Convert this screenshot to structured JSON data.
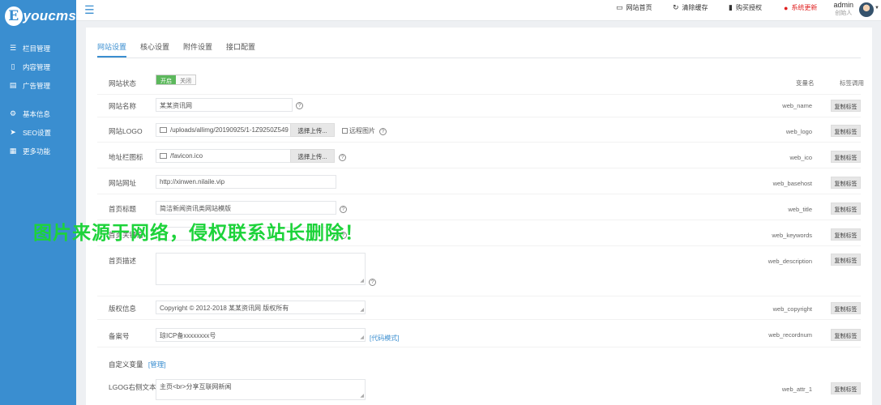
{
  "logo": {
    "mark": "E",
    "text": "youcms"
  },
  "sidebar": {
    "group1": [
      {
        "icon": "☰",
        "label": "栏目管理"
      },
      {
        "icon": "▯",
        "label": "内容管理"
      },
      {
        "icon": "▤",
        "label": "广告管理"
      }
    ],
    "group2": [
      {
        "icon": "⚙",
        "label": "基本信息"
      },
      {
        "icon": "➤",
        "label": "SEO设置"
      },
      {
        "icon": "▦",
        "label": "更多功能"
      }
    ]
  },
  "topbar": {
    "site_home": "网站首页",
    "clear_cache": "清除缓存",
    "buy_license": "购买授权",
    "system_update": "系统更新",
    "admin_name": "admin",
    "admin_role": "创始人"
  },
  "tabs": [
    "网站设置",
    "核心设置",
    "附件设置",
    "接口配置"
  ],
  "headers": {
    "var_name": "变量名",
    "tag_call": "标签调用"
  },
  "copy_label": "复制标签",
  "upload_label": "选择上传...",
  "remote_label": "远程图片",
  "code_mode": "[代码模式]",
  "help_mark": "?",
  "fields": {
    "status": {
      "label": "网站状态",
      "on": "开启",
      "off": "关闭"
    },
    "name": {
      "label": "网站名称",
      "value": "某某资讯网",
      "var": "web_name"
    },
    "logo": {
      "label": "网站LOGO",
      "value": "/uploads/allimg/20190925/1-1Z9250Z549",
      "var": "web_logo"
    },
    "ico": {
      "label": "地址栏图标",
      "value": "/favicon.ico",
      "var": "web_ico"
    },
    "basehost": {
      "label": "网站网址",
      "value": "http://xinwen.nilaile.vip",
      "var": "web_basehost"
    },
    "title": {
      "label": "首页标题",
      "value": "简洁新闻资讯类网站模版",
      "var": "web_title"
    },
    "keywords": {
      "label": "首页关键词",
      "value": "",
      "var": "web_keywords"
    },
    "description": {
      "label": "首页描述",
      "value": "",
      "var": "web_description"
    },
    "copyright": {
      "label": "版权信息",
      "value": "Copyright © 2012-2018 某某资讯网 版权所有",
      "var": "web_copyright"
    },
    "recordnum": {
      "label": "备案号",
      "value": "琼ICP备xxxxxxxx号",
      "var": "web_recordnum"
    },
    "attr1": {
      "label": "LGOG右侧文本",
      "value": "主页<br>分享互联网新闻",
      "var": "web_attr_1"
    }
  },
  "custom_vars": {
    "label": "自定义变量",
    "manage": "[管理]"
  },
  "watermark": "图片来源于网络，侵权联系站长删除！"
}
